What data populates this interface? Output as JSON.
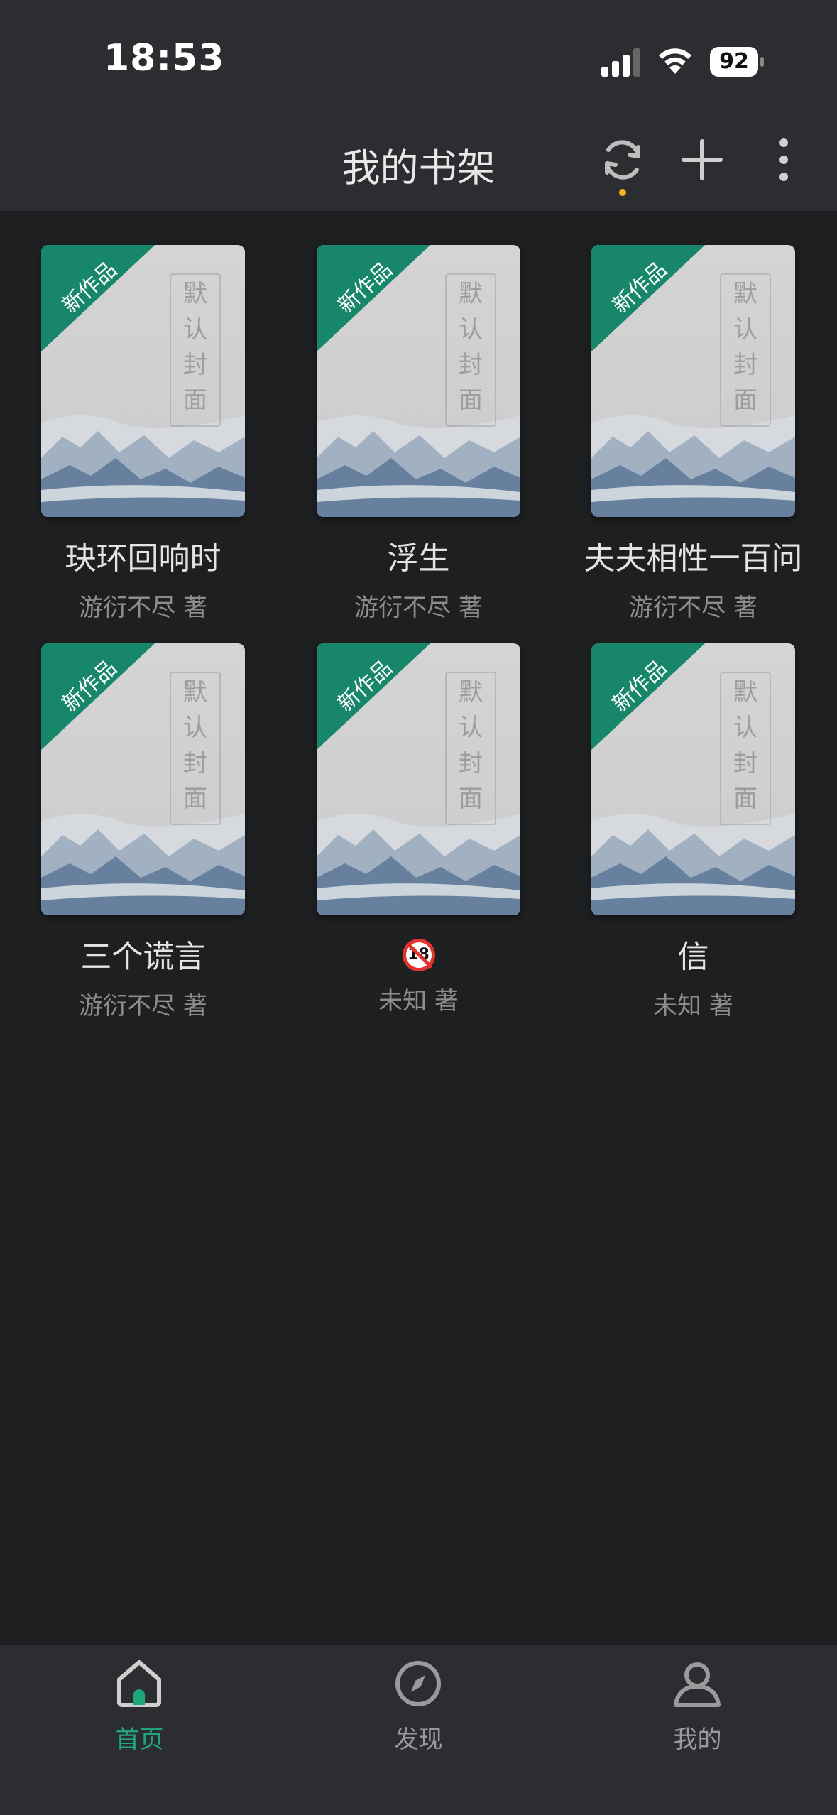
{
  "status_bar": {
    "time": "18:53",
    "battery": "92"
  },
  "header": {
    "title": "我的书架",
    "refresh_icon": "refresh-icon",
    "add_icon": "plus-icon",
    "more_icon": "more-vertical-icon"
  },
  "cover": {
    "ribbon_text": "新作品",
    "label_chars": [
      "默",
      "认",
      "封",
      "面"
    ]
  },
  "books": [
    {
      "title": "玦环回响时",
      "author": "游衍不尽 著"
    },
    {
      "title": "浮生",
      "author": "游衍不尽 著"
    },
    {
      "title": "夫夫相性一百问",
      "author": "游衍不尽 著"
    },
    {
      "title": "三个谎言",
      "author": "游衍不尽 著"
    },
    {
      "title": "",
      "author": "未知 著",
      "title_icon": "no-under-18-icon"
    },
    {
      "title": "信",
      "author": "未知 著"
    }
  ],
  "tabbar": {
    "tabs": [
      {
        "label": "首页",
        "icon": "home-icon",
        "active": true
      },
      {
        "label": "发现",
        "icon": "compass-icon",
        "active": false
      },
      {
        "label": "我的",
        "icon": "user-icon",
        "active": false
      }
    ]
  },
  "colors": {
    "accent": "#1fa67a",
    "ribbon": "#17866a",
    "background": "#1e1f21",
    "bar": "#2c2d30",
    "refresh_dot": "#f2b51e"
  }
}
